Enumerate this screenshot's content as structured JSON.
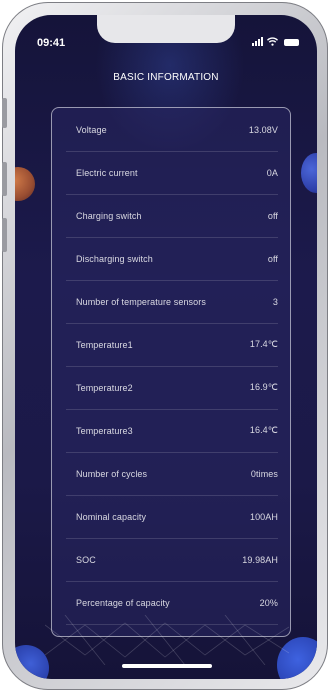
{
  "status_bar": {
    "time": "09:41",
    "icons": [
      "signal-icon",
      "wifi-icon",
      "battery-icon"
    ]
  },
  "page": {
    "title": "BASIC INFORMATION"
  },
  "rows": [
    {
      "label": "Voltage",
      "value": "13.08V"
    },
    {
      "label": "Electric current",
      "value": "0A"
    },
    {
      "label": "Charging switch",
      "value": "off"
    },
    {
      "label": "Discharging switch",
      "value": "off"
    },
    {
      "label": "Number of temperature sensors",
      "value": "3"
    },
    {
      "label": "Temperature1",
      "value": "17.4℃"
    },
    {
      "label": "Temperature2",
      "value": "16.9℃"
    },
    {
      "label": "Temperature3",
      "value": "16.4℃"
    },
    {
      "label": "Number of cycles",
      "value": "0times"
    },
    {
      "label": "Nominal capacity",
      "value": "100AH"
    },
    {
      "label": "SOC",
      "value": "19.98AH"
    },
    {
      "label": "Percentage of capacity",
      "value": "20%"
    }
  ],
  "colors": {
    "background": "#1b1948",
    "card_border": "#c8c8dc",
    "text": "#ffffff"
  }
}
